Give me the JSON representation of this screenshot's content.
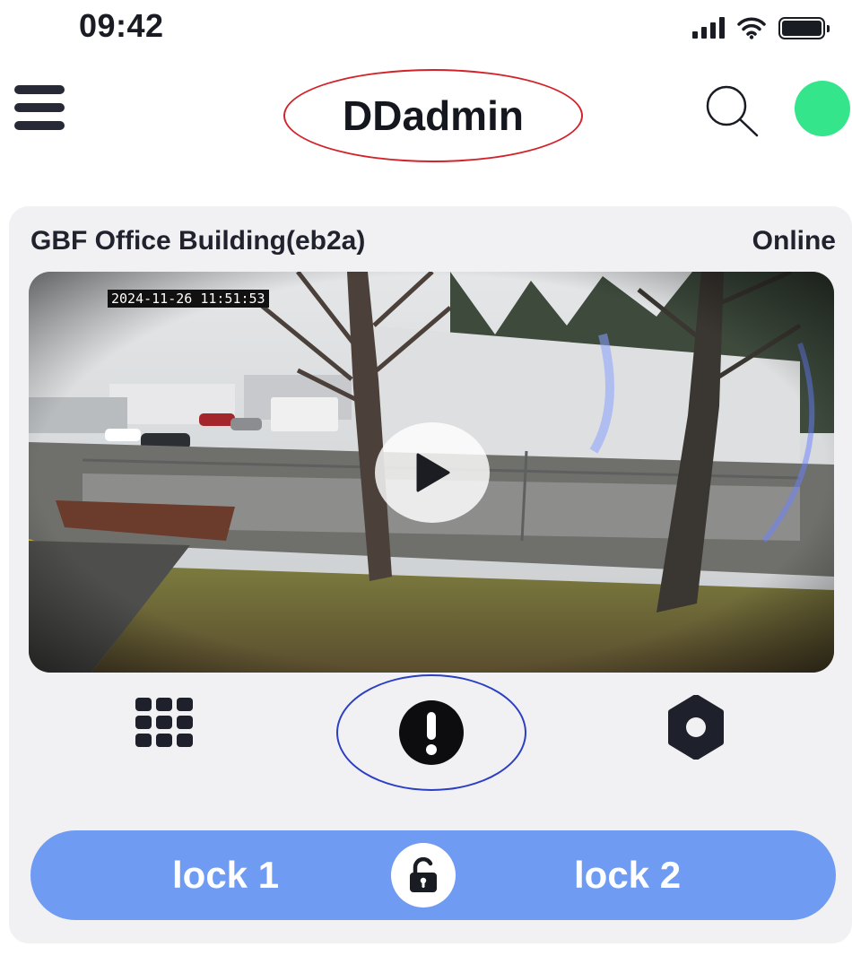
{
  "status_bar": {
    "time": "09:42",
    "icons": [
      "signal-icon",
      "wifi-icon",
      "battery-icon"
    ]
  },
  "header": {
    "title": "DDadmin",
    "menu_icon": "hamburger-menu-icon",
    "search_icon": "search-icon",
    "status_color": "#35e58b"
  },
  "device": {
    "name": "GBF Office Building(eb2a)",
    "status": "Online",
    "video": {
      "timestamp": "2024-11-26 11:51:53",
      "play_icon": "play-icon"
    },
    "actions": {
      "grid_icon": "grid-icon",
      "alert_icon": "alert-icon",
      "settings_icon": "gear-icon"
    },
    "locks": {
      "lock1_label": "lock 1",
      "lock2_label": "lock 2",
      "unlock_icon": "unlock-icon"
    }
  },
  "colors": {
    "lock_bar": "#6f9cf2",
    "title_highlight": "#d2232a",
    "alert_highlight": "#2b3fc2"
  }
}
